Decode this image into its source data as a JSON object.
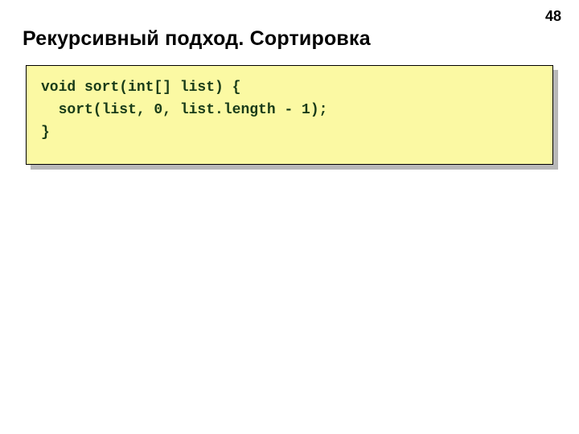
{
  "slide": {
    "page_number": "48",
    "title": "Рекурсивный подход. Сортировка",
    "code": "void sort(int[] list) {\n  sort(list, 0, list.length - 1);\n}"
  }
}
